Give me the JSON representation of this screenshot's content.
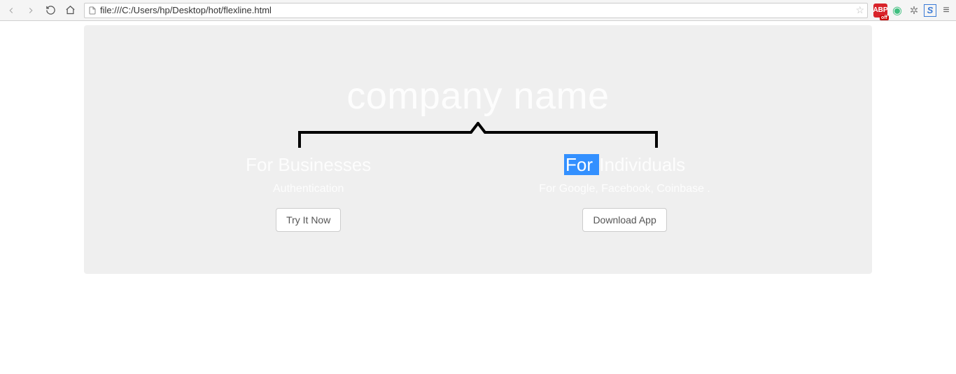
{
  "browser": {
    "url": "file:///C:/Users/hp/Desktop/hot/flexline.html",
    "abp_label": "ABP",
    "abp_sub": "off",
    "s_label": "S"
  },
  "hero": {
    "title": "company name",
    "left": {
      "title": "For Businesses",
      "subtitle": "Authentication",
      "button": "Try It Now"
    },
    "right": {
      "title_highlight": "For ",
      "title_rest": "Individuals",
      "subtitle": "For Google, Facebook, Coinbase .",
      "button": "Download App"
    }
  }
}
